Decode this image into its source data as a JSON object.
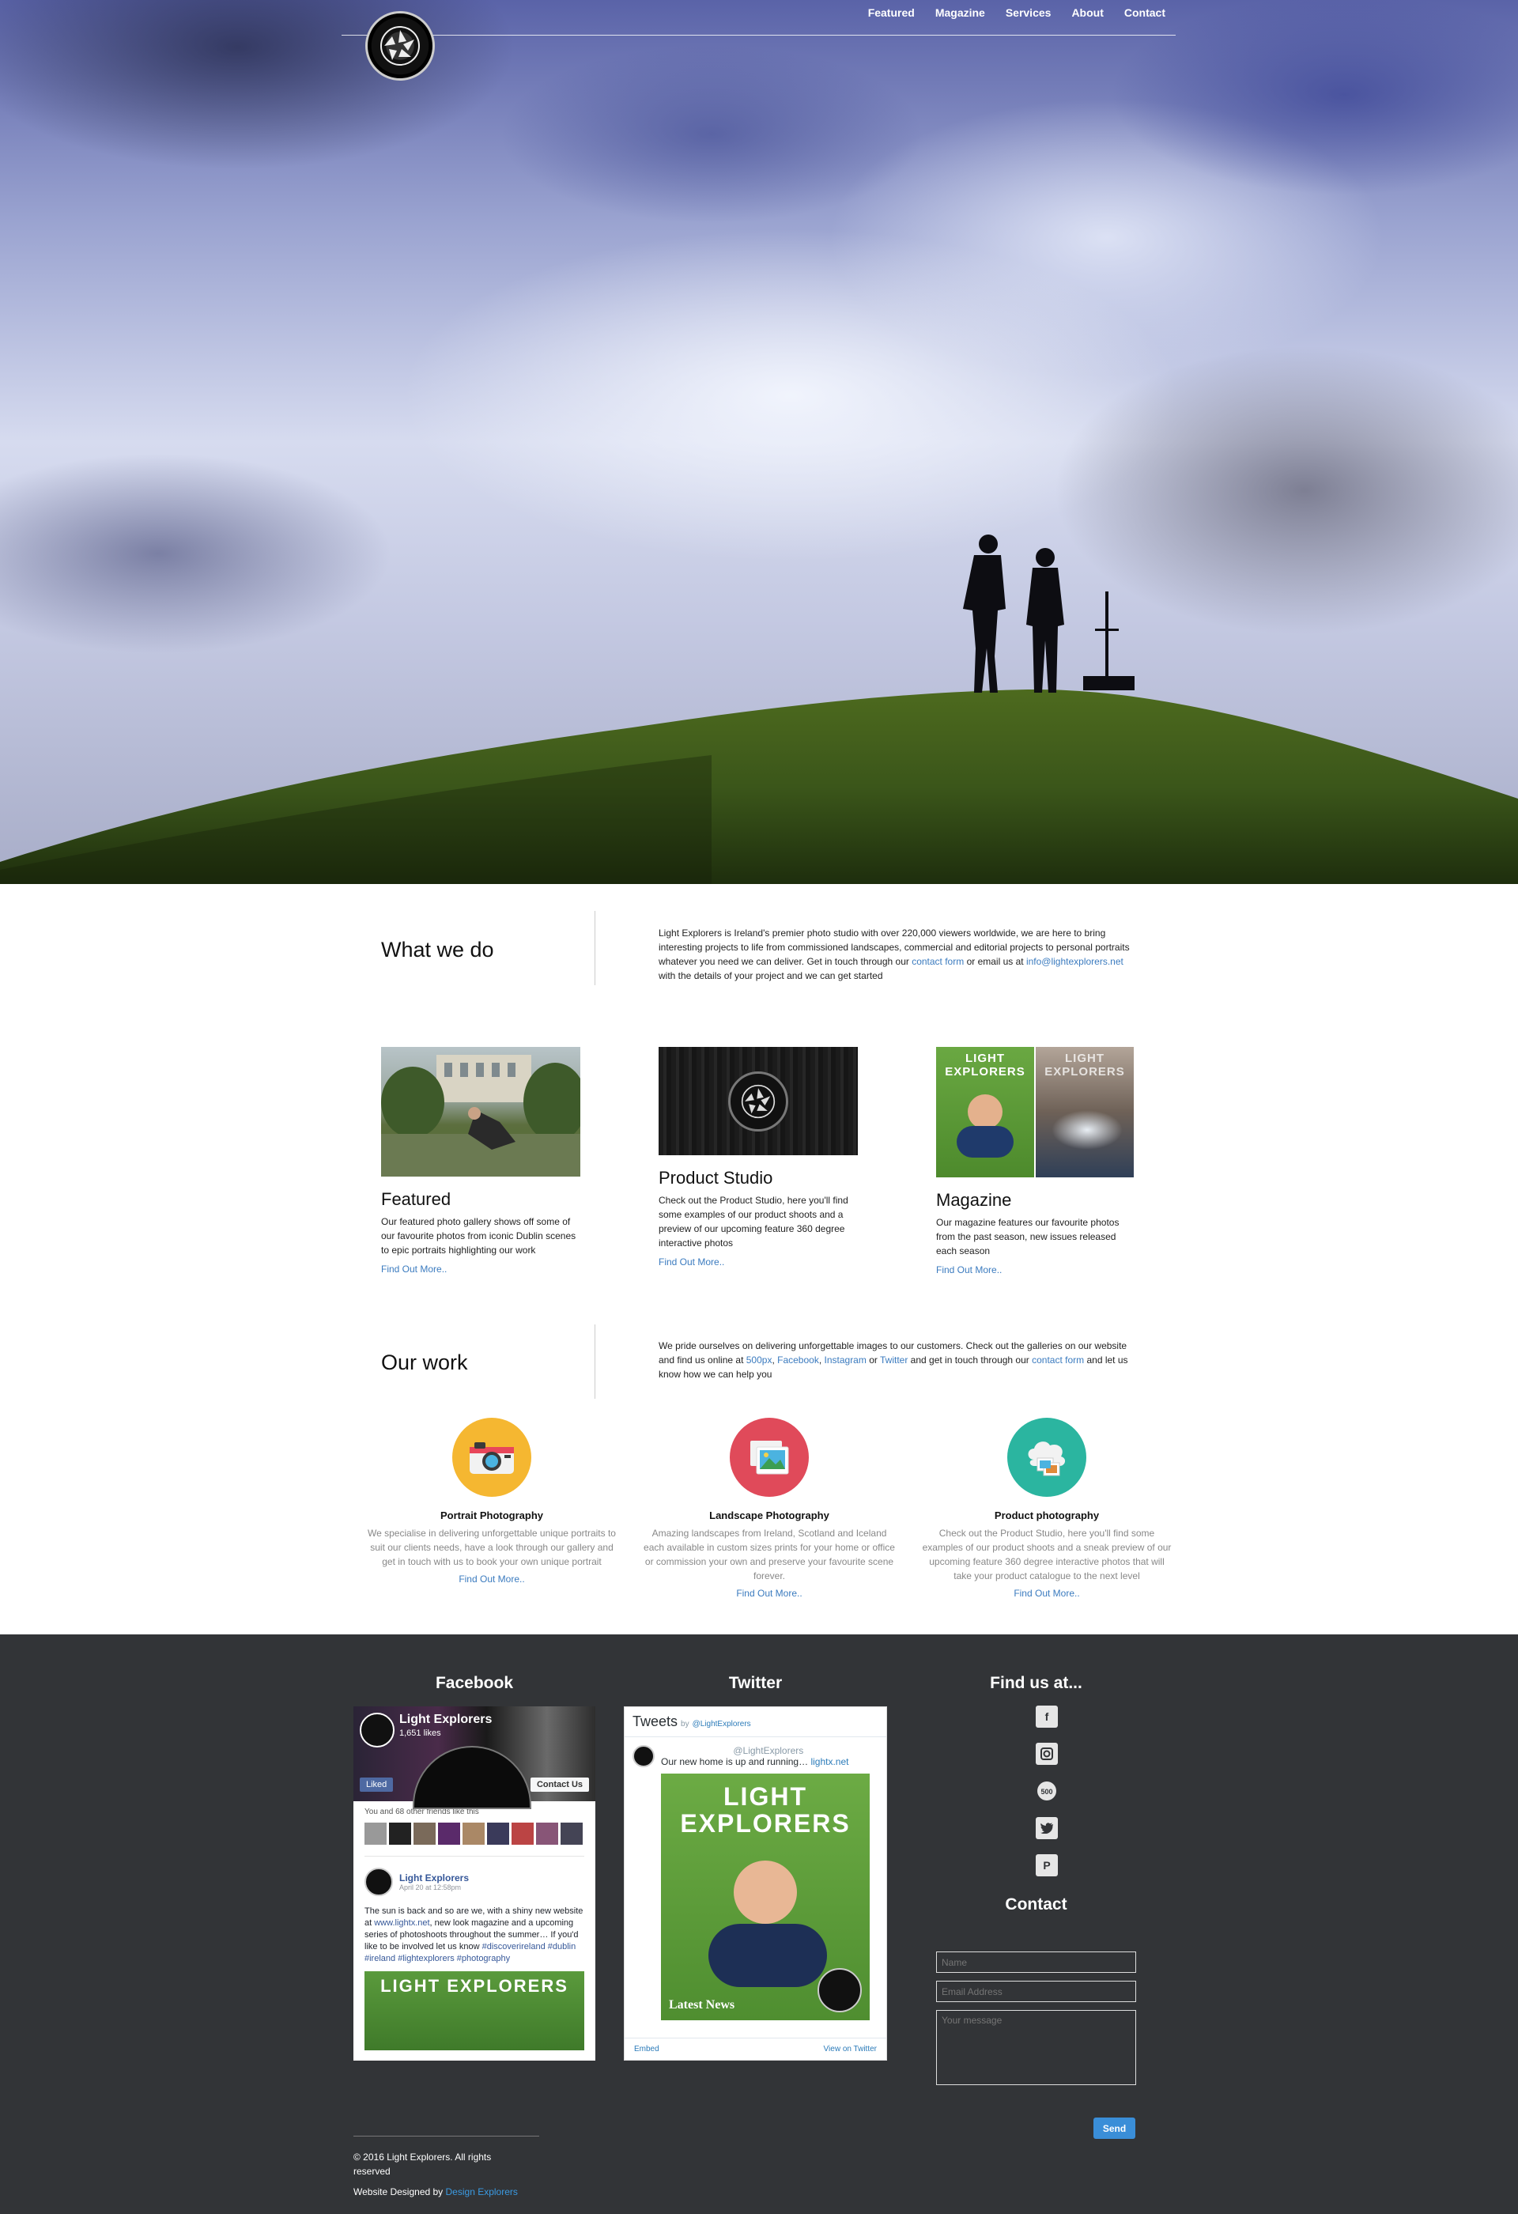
{
  "nav": {
    "items": [
      "Featured",
      "Magazine",
      "Services",
      "About",
      "Contact"
    ]
  },
  "about": {
    "title": "What we do",
    "text_1": "Light Explorers is Ireland's premier photo studio with over 220,000 viewers worldwide, we are here to bring interesting projects to life from commissioned landscapes, commercial and editorial projects to personal portraits whatever you need we can deliver. Get in touch through our ",
    "link_contact": "contact form",
    "text_2": " or email us at ",
    "link_email": "info@lightexplorers.net",
    "text_3": " with the details of your project and we can get started"
  },
  "cards": [
    {
      "title": "Featured",
      "text": "Our featured photo gallery shows off some of our favourite photos from iconic Dublin scenes to epic portraits highlighting our work",
      "more": "Find Out More.."
    },
    {
      "title": "Product Studio",
      "text": "Check out the Product Studio, here you'll find some examples of our product shoots and a preview of our upcoming feature 360 degree interactive photos",
      "more": "Find Out More.."
    },
    {
      "title": "Magazine",
      "text": "Our magazine features our favourite photos from the past season, new issues released each season",
      "more": "Find Out More.."
    }
  ],
  "magazine_cover": {
    "brand": "LIGHT EXPLORERS"
  },
  "work": {
    "title": "Our work",
    "text_1": "We pride ourselves on delivering unforgettable images to our customers. Check out the galleries on our website and find us online at ",
    "link_500px": "500px",
    "sep_1": ", ",
    "link_facebook": "Facebook",
    "sep_2": ", ",
    "link_instagram": "Instagram",
    "sep_3": " or ",
    "link_twitter": "Twitter",
    "text_2": " and get in touch through our ",
    "link_contact": "contact form",
    "text_3": " and let us know how we can help you"
  },
  "services": [
    {
      "title": "Portrait Photography",
      "text": "We specialise in delivering unforgettable unique portraits to suit our clients needs, have a look through our gallery and get in touch with us to book your own unique portrait",
      "more": "Find Out More..",
      "color": "#f5b731",
      "icon": "camera-icon"
    },
    {
      "title": "Landscape Photography",
      "text": "Amazing landscapes from Ireland, Scotland and Iceland each available in custom sizes prints for your home or office or commission your own and preserve your favourite scene forever.",
      "more": "Find Out More..",
      "color": "#e04a5a",
      "icon": "picture-icon"
    },
    {
      "title": "Product photography",
      "text": "Check out the Product Studio, here you'll find some examples of our product shoots and a sneak preview of our upcoming feature 360 degree interactive photos that will take your product catalogue to the next level",
      "more": "Find Out More..",
      "color": "#2bb5a0",
      "icon": "cloud-gallery-icon"
    }
  ],
  "footer": {
    "facebook_title": "Facebook",
    "twitter_title": "Twitter",
    "find_title": "Find us at...",
    "contact_title": "Contact",
    "copyright": "© 2016 Light Explorers. All rights reserved",
    "credit_prefix": "Website Designed by ",
    "credit_link": "Design Explorers"
  },
  "fb": {
    "page_name": "Light Explorers",
    "likes": "1,651 likes",
    "liked_btn": "Liked",
    "contact_btn": "Contact Us",
    "friends_text": "You and 68 other friends like this",
    "post_author": "Light Explorers",
    "post_date": "April 20 at 12:58pm",
    "post_text_1": "The sun is back and so are we, with a shiny new website at ",
    "post_link": "www.lightx.net",
    "post_text_2": ", new look magazine and a upcoming series of photoshoots throughout the summer… If you'd like to be involved let us know ",
    "post_tags": "#discoverireland #dublin #ireland #lightexplorers #photography",
    "image_brand": "LIGHT EXPLORERS"
  },
  "tw": {
    "header": "Tweets",
    "by": "by",
    "handle": "@LightExplorers",
    "author": "Light Explorers",
    "tweet_text": "Our new home is up and running… ",
    "tweet_link": "lightx.net",
    "image_brand": "LIGHT EXPLORERS",
    "image_caption": "Latest News",
    "embed": "Embed",
    "view": "View on Twitter"
  },
  "contact_form": {
    "name_placeholder": "Name",
    "email_placeholder": "Email Address",
    "message_placeholder": "Your message",
    "send_label": "Send"
  },
  "social": [
    "facebook-icon",
    "instagram-icon",
    "500px-icon",
    "twitter-icon",
    "pinterest-icon"
  ]
}
